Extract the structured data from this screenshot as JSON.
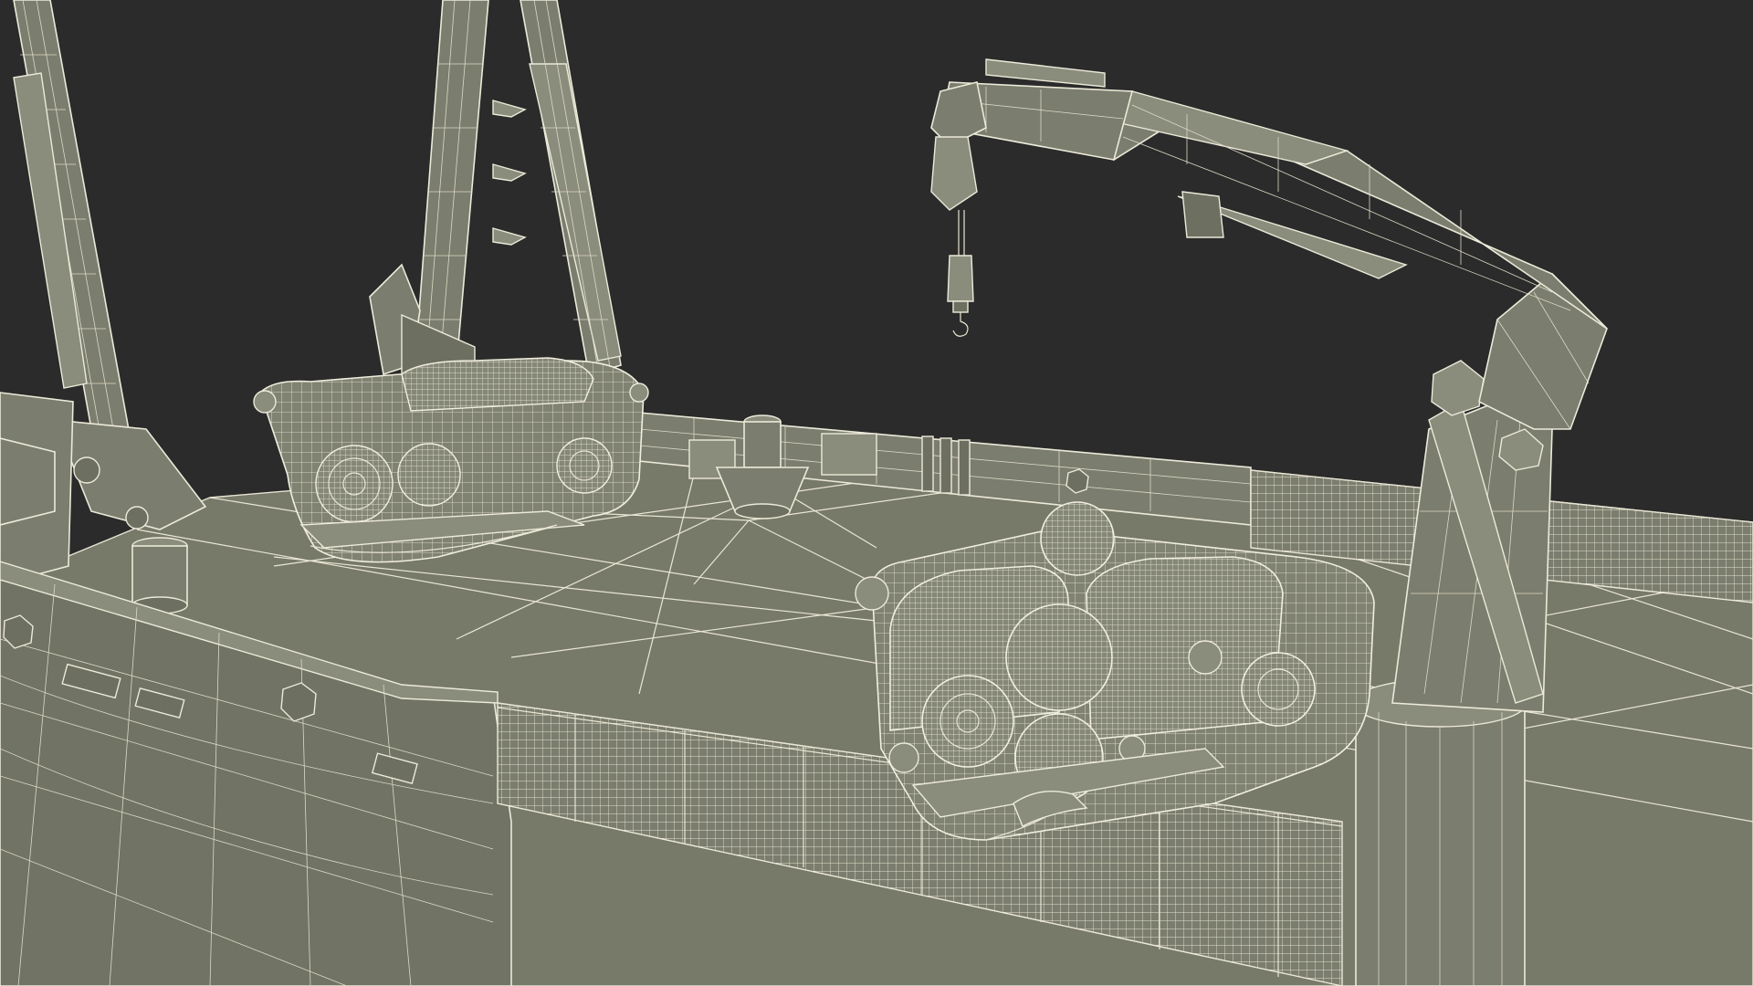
{
  "scene": {
    "background_color": "#2b2b2b",
    "model_fill_color": "#777969",
    "wireframe_color": "#e9e6d4",
    "objects": [
      "ship-deck",
      "ship-hull",
      "knuckle-boom-crane",
      "crane-hook",
      "a-frame-left",
      "a-frame-center",
      "rov-rear",
      "rov-front",
      "deck-railing",
      "bollard",
      "capstan"
    ]
  }
}
